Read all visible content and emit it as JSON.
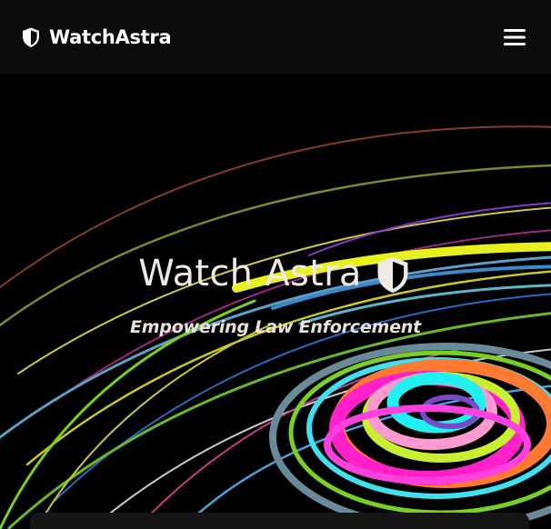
{
  "navbar": {
    "brand_name": "WatchAstra",
    "brand_icon": "shield-icon",
    "menu_icon": "hamburger-menu-icon"
  },
  "hero": {
    "title": "Watch Astra",
    "title_icon": "shield-icon",
    "subtitle": "Empowering Law Enforcement",
    "background": "swirling colorful rings"
  },
  "colors": {
    "navbar_bg": "#0b0b0b",
    "page_bg": "#000000",
    "title_text": "#efe9e4",
    "card_bg": "#161616"
  }
}
